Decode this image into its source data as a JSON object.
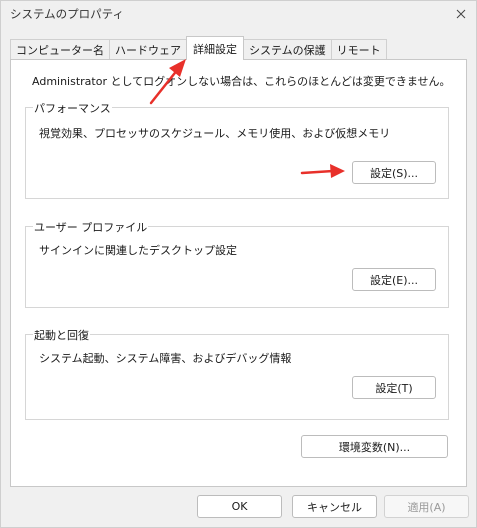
{
  "window": {
    "title": "システムのプロパティ"
  },
  "tabs": [
    {
      "label": "コンピューター名",
      "active": false
    },
    {
      "label": "ハードウェア",
      "active": false
    },
    {
      "label": "詳細設定",
      "active": true
    },
    {
      "label": "システムの保護",
      "active": false
    },
    {
      "label": "リモート",
      "active": false
    }
  ],
  "panel": {
    "notice": "Administrator としてログオンしない場合は、これらのほとんどは変更できません。",
    "performance": {
      "legend": "パフォーマンス",
      "description": "視覚効果、プロセッサのスケジュール、メモリ使用、および仮想メモリ",
      "button": "設定(S)..."
    },
    "profile": {
      "legend": "ユーザー プロファイル",
      "description": "サインインに関連したデスクトップ設定",
      "button": "設定(E)..."
    },
    "startup": {
      "legend": "起動と回復",
      "description": "システム起動、システム障害、およびデバッグ情報",
      "button": "設定(T)"
    },
    "env_button": "環境変数(N)..."
  },
  "footer": {
    "ok": "OK",
    "cancel": "キャンセル",
    "apply": "適用(A)"
  },
  "colors": {
    "annotation_arrow": "#e8302a"
  },
  "icons": {
    "close": "close-icon",
    "arrow": "annotation-arrow-icon"
  }
}
